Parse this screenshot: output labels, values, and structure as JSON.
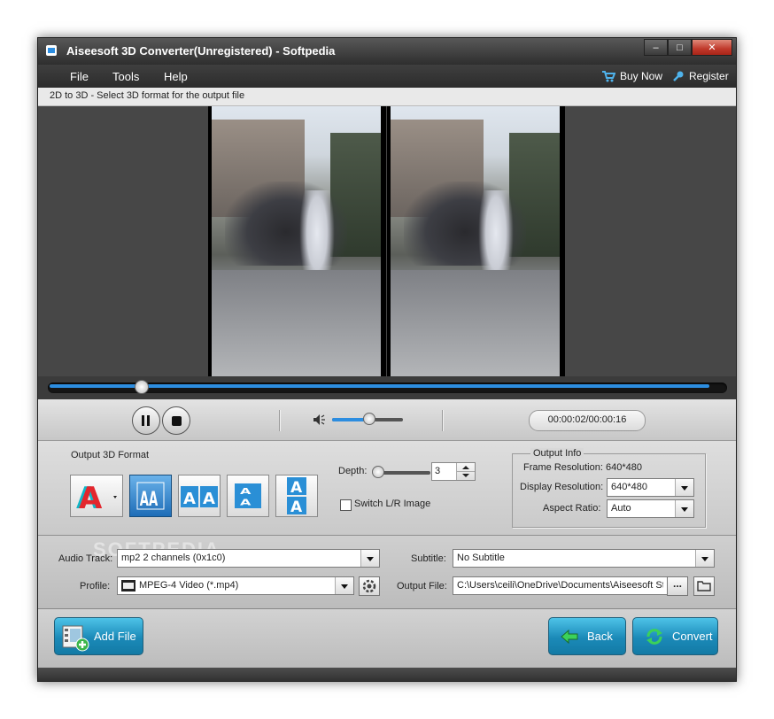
{
  "window": {
    "title": "Aiseesoft 3D Converter(Unregistered) - Softpedia",
    "controls": [
      "minimize",
      "maximize",
      "close"
    ]
  },
  "menu": {
    "items": [
      "File",
      "Tools",
      "Help"
    ],
    "buy_now": "Buy Now",
    "register": "Register"
  },
  "status_text": "2D to 3D - Select 3D format for the output file",
  "player": {
    "seek_fraction": 0.14,
    "volume_fraction": 0.52,
    "time": "00:00:02/00:00:16"
  },
  "output_format": {
    "label": "Output 3D Format",
    "buttons": [
      {
        "icon": "anaglyph-icon",
        "selected": false
      },
      {
        "icon": "side-by-side-half-icon",
        "selected": true
      },
      {
        "icon": "side-by-side-full-icon",
        "selected": false
      },
      {
        "icon": "top-bottom-half-icon",
        "selected": false
      },
      {
        "icon": "top-bottom-full-icon",
        "selected": false
      }
    ],
    "depth_label": "Depth:",
    "depth_value": "3",
    "switch_label": "Switch L/R Image",
    "switch_checked": false
  },
  "output_info": {
    "title": "Output Info",
    "frame_resolution_label": "Frame Resolution:",
    "frame_resolution_value": "640*480",
    "display_resolution_label": "Display Resolution:",
    "display_resolution_value": "640*480",
    "aspect_ratio_label": "Aspect Ratio:",
    "aspect_ratio_value": "Auto"
  },
  "io": {
    "audio_track_label": "Audio Track:",
    "audio_track_value": "mp2 2 channels (0x1c0)",
    "subtitle_label": "Subtitle:",
    "subtitle_value": "No Subtitle",
    "profile_label": "Profile:",
    "profile_value": "MPEG-4 Video (*.mp4)",
    "output_file_label": "Output File:",
    "output_file_value": "C:\\Users\\ceili\\OneDrive\\Documents\\Aiseesoft Stu",
    "browse_label": "...",
    "watermark": "SOFTPEDIA"
  },
  "actions": {
    "add_file": "Add File",
    "back": "Back",
    "convert": "Convert"
  },
  "colors": {
    "accent": "#2c8de0",
    "button_blue": "#1b8ab8",
    "close_red": "#c0392b"
  }
}
